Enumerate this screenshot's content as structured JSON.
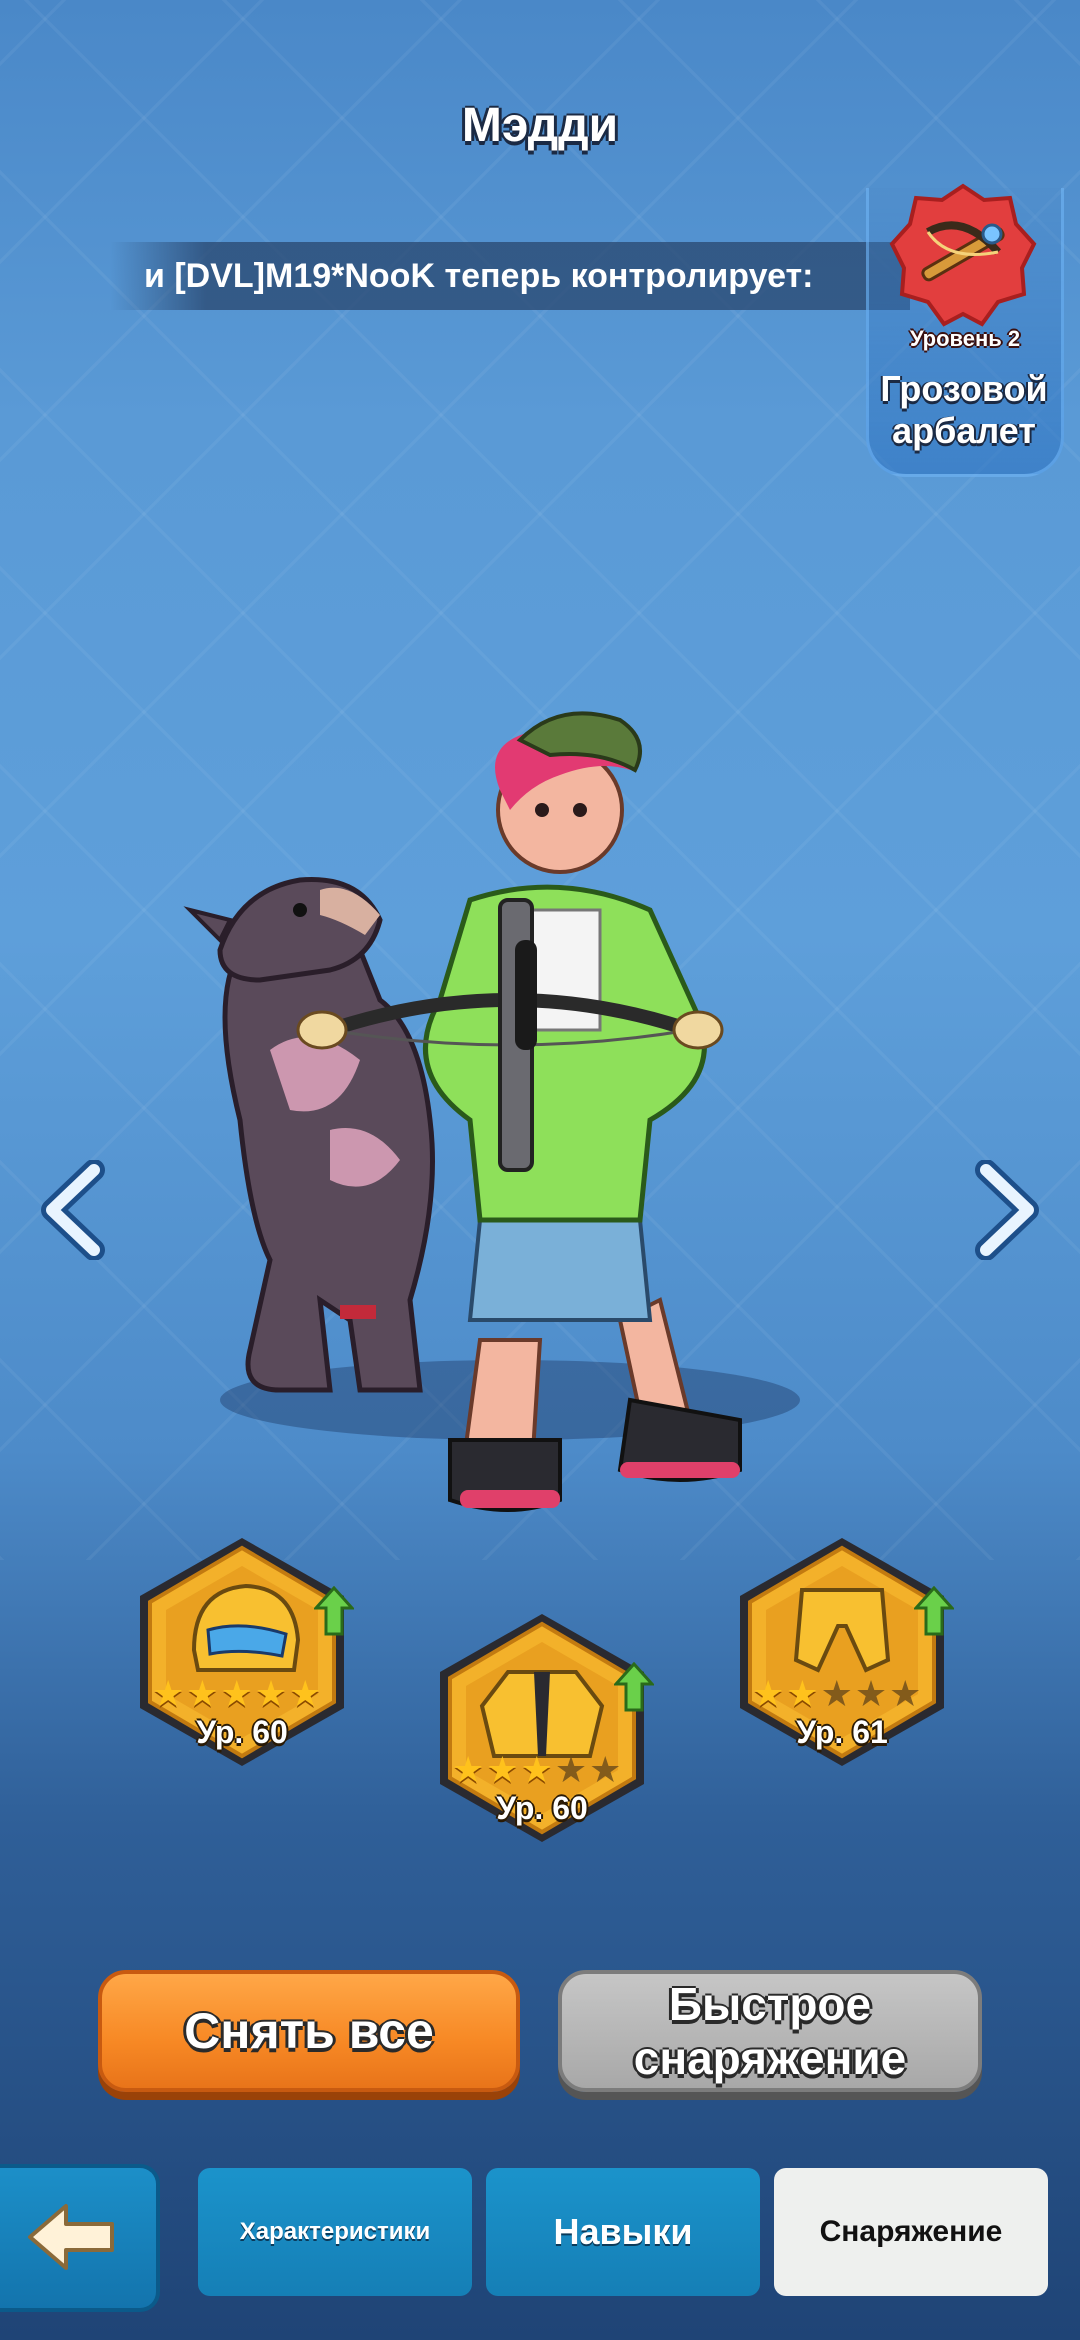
{
  "hero": {
    "name": "Мэдди"
  },
  "ticker": {
    "text": "и [DVL]M19*NooK теперь контролирует:"
  },
  "weapon": {
    "level_label": "Уровень 2",
    "name_line1": "Грозовой",
    "name_line2": "арбалет"
  },
  "gear": [
    {
      "slot": "helmet",
      "level_label": "Ур. 60",
      "stars": 5,
      "max_stars": 5
    },
    {
      "slot": "jacket",
      "level_label": "Ур. 60",
      "stars": 3,
      "max_stars": 5
    },
    {
      "slot": "pants",
      "level_label": "Ур. 61",
      "stars": 2,
      "max_stars": 5
    }
  ],
  "buttons": {
    "unequip_all": "Снять все",
    "quick_equip_line1": "Быстрое",
    "quick_equip_line2": "снаряжение"
  },
  "tabs": [
    {
      "label": "Характеристики",
      "active": false
    },
    {
      "label": "Навыки",
      "active": false
    },
    {
      "label": "Снаряжение",
      "active": true
    }
  ],
  "icons": {
    "back": "back-arrow-icon",
    "prev": "chevron-left-icon",
    "next": "chevron-right-icon",
    "weapon": "crossbow-icon",
    "upgrade": "upgrade-arrow-icon"
  },
  "colors": {
    "orange_button": "#f78824",
    "grey_button": "#a8a8a8",
    "tab_blue": "#1b93cb",
    "gear_gold": "#f0a81c"
  }
}
